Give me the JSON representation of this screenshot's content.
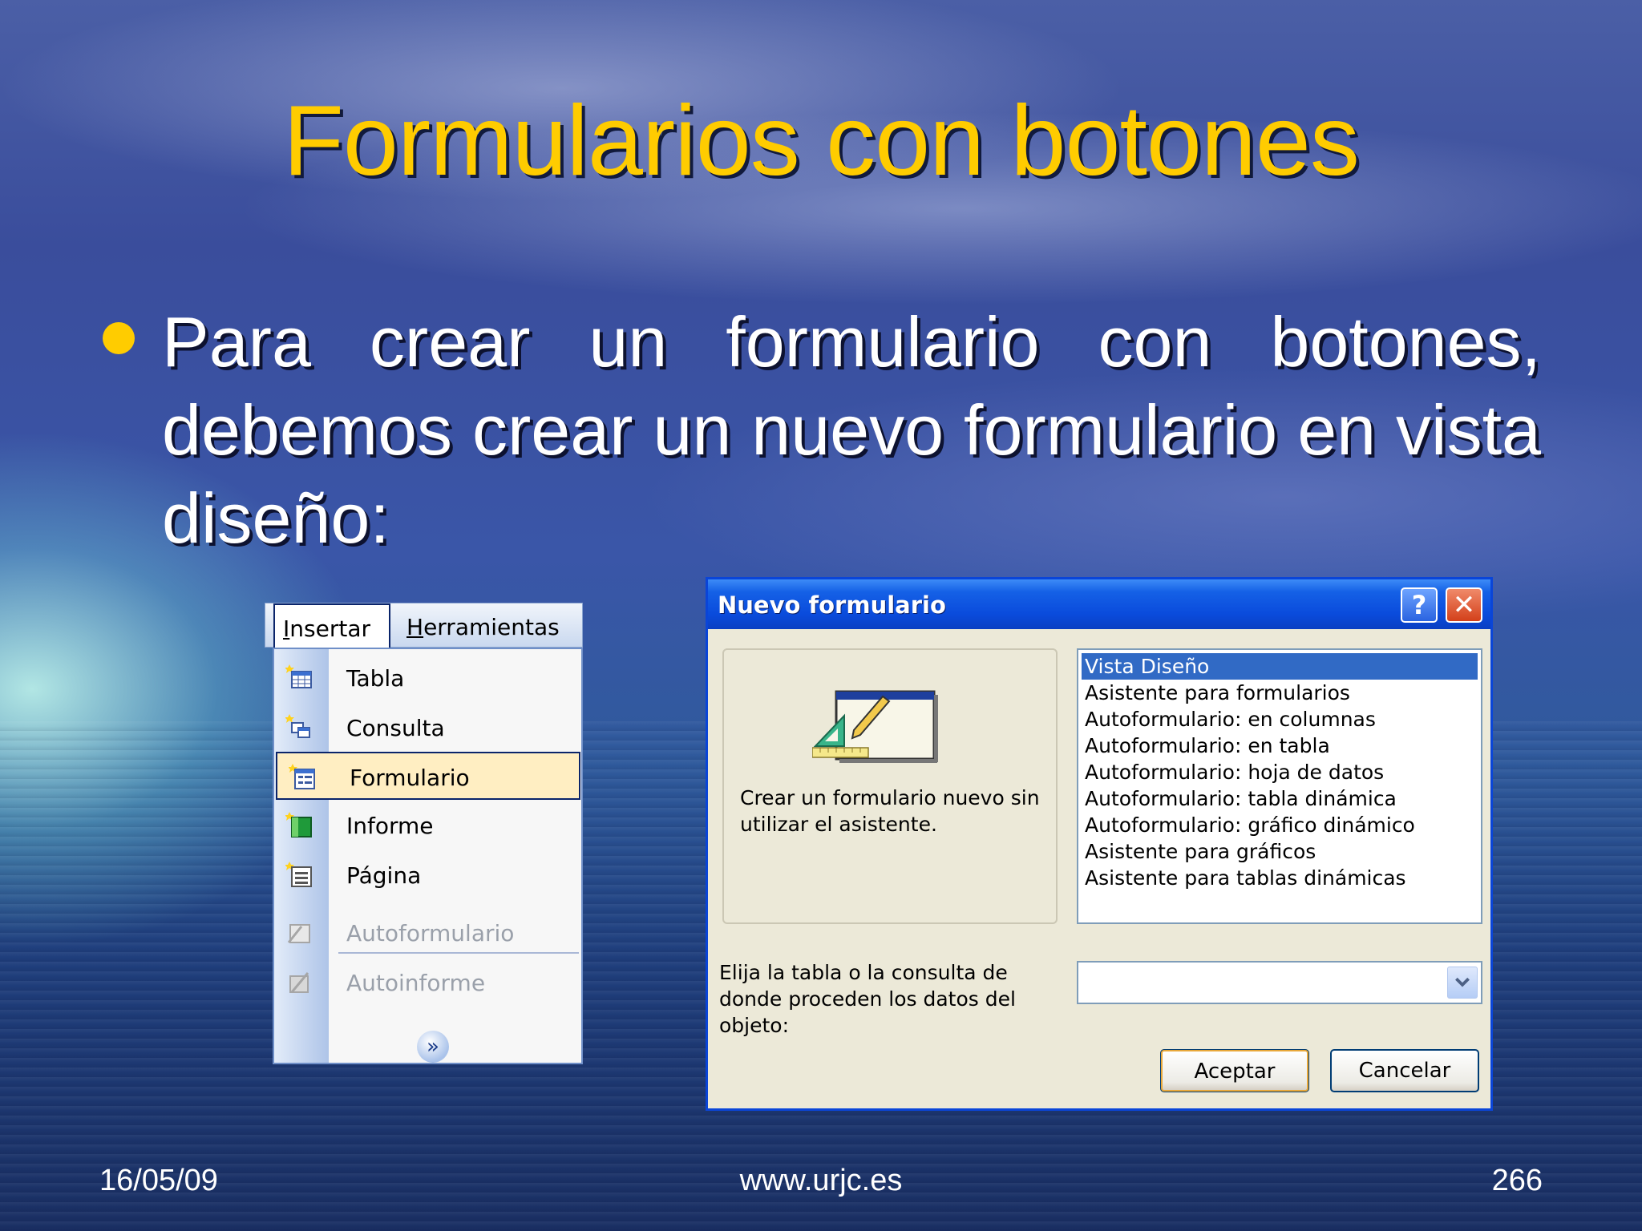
{
  "slide": {
    "title": "Formularios con botones",
    "bullet": "Para crear un formulario con botones, debemos crear un nuevo formulario en vista diseño:",
    "footer": {
      "date": "16/05/09",
      "url": "www.urjc.es",
      "page": "266"
    }
  },
  "insert_menu": {
    "menubar": [
      "Insertar",
      "Herramientas"
    ],
    "items": [
      {
        "label": "Tabla",
        "icon": "table-icon",
        "enabled": true
      },
      {
        "label": "Consulta",
        "icon": "query-icon",
        "enabled": true
      },
      {
        "label": "Formulario",
        "icon": "form-icon",
        "enabled": true,
        "highlighted": true
      },
      {
        "label": "Informe",
        "icon": "report-icon",
        "enabled": true
      },
      {
        "label": "Página",
        "icon": "page-icon",
        "enabled": true
      },
      {
        "label": "Autoformulario",
        "icon": "autoform-icon",
        "enabled": false
      },
      {
        "label": "Autoinforme",
        "icon": "autoreport-icon",
        "enabled": false
      }
    ],
    "more_icon": "chevron-double-down-icon"
  },
  "dialog": {
    "title": "Nuevo formulario",
    "help_label": "?",
    "close_label": "✕",
    "description": "Crear un formulario nuevo sin utilizar el asistente.",
    "options": [
      "Vista Diseño",
      "Asistente para formularios",
      "Autoformulario: en columnas",
      "Autoformulario: en tabla",
      "Autoformulario: hoja de datos",
      "Autoformulario: tabla dinámica",
      "Autoformulario: gráfico dinámico",
      "Asistente para gráficos",
      "Asistente para tablas dinámicas"
    ],
    "selected_option": "Vista Diseño",
    "source_label": "Elija la tabla o la consulta de donde proceden los datos del objeto:",
    "source_value": "",
    "ok_label": "Aceptar",
    "cancel_label": "Cancelar"
  },
  "colors": {
    "title": "#ffcc00",
    "accent_titlebar": "#0a4bdc",
    "selection": "#316ac5",
    "menu_highlight": "#ffeec2"
  }
}
